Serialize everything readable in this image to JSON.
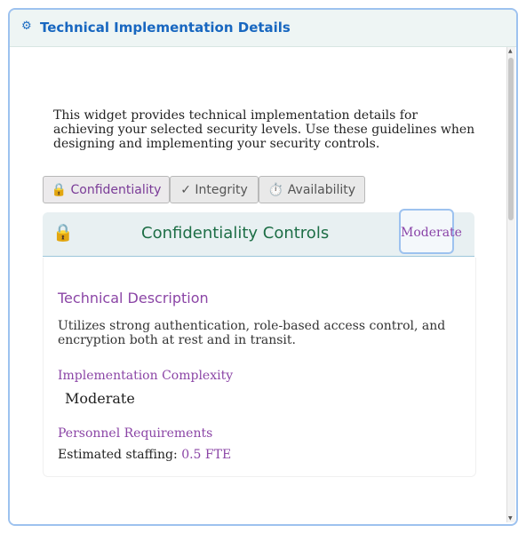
{
  "header": {
    "icon": "gear-icon",
    "icon_glyph": "⚙",
    "title": "Technical Implementation Details"
  },
  "intro": "This widget provides technical implementation details for achieving your selected security levels. Use these guidelines when designing and implementing your security controls.",
  "tabs": [
    {
      "label": "🔒 Confidentiality",
      "active": true
    },
    {
      "label": "✓ Integrity",
      "active": false
    },
    {
      "label": "⏱️ Availability",
      "active": false
    }
  ],
  "panel": {
    "lock_icon": "🔒",
    "title": "Confidentiality Controls",
    "level_badge": "Moderate",
    "description_heading": "Technical Description",
    "description": "Utilizes strong authentication, role-based access control, and encryption both at rest and in transit.",
    "complexity_label": "Implementation Complexity",
    "complexity_value": "Moderate",
    "personnel_label": "Personnel Requirements",
    "staffing_label": "Estimated staffing:",
    "staffing_value": "0.5 FTE"
  },
  "colors": {
    "accent_blue": "#1867c0",
    "accent_purple": "#8b45a6",
    "title_green": "#1d6e46"
  }
}
